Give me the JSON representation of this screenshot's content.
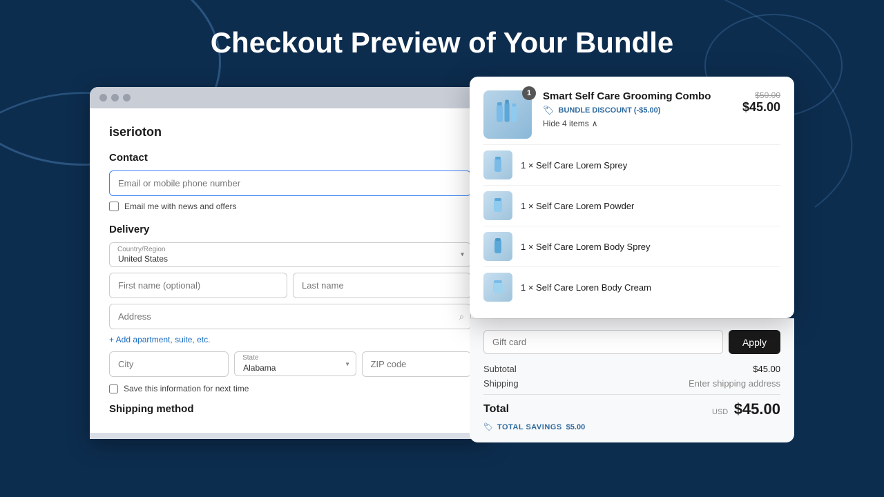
{
  "page": {
    "title": "Checkout Preview of Your Bundle",
    "background_color": "#0d2d4f"
  },
  "browser": {
    "store_name": "iserioton"
  },
  "contact": {
    "label": "Contact",
    "email_placeholder": "Email or mobile phone number",
    "newsletter_label": "Email me with news and offers"
  },
  "delivery": {
    "label": "Delivery",
    "country_label": "Country/Region",
    "country_value": "United States",
    "first_name_placeholder": "First name (optional)",
    "last_name_placeholder": "Last name",
    "address_placeholder": "Address",
    "add_apartment_label": "+ Add apartment, suite, etc.",
    "city_placeholder": "City",
    "state_label": "State",
    "state_value": "Alabama",
    "zip_placeholder": "ZIP code",
    "save_info_label": "Save this information for next time"
  },
  "shipping_method": {
    "label": "Shipping method"
  },
  "bundle": {
    "badge": "1",
    "title": "Smart Self Care Grooming Combo",
    "discount_label": "BUNDLE DISCOUNT (-$5.00)",
    "hide_items_label": "Hide 4 items",
    "original_price": "$50.00",
    "final_price": "$45.00",
    "items": [
      {
        "name": "1 × Self Care Lorem Sprey"
      },
      {
        "name": "1 × Self Care Lorem Powder"
      },
      {
        "name": "1 × Self Care Lorem Body Sprey"
      },
      {
        "name": "1 × Self Care Loren Body Cream"
      }
    ]
  },
  "order_summary": {
    "gift_card_placeholder": "Gift card",
    "apply_label": "Apply",
    "subtotal_label": "Subtotal",
    "subtotal_value": "$45.00",
    "shipping_label": "Shipping",
    "shipping_value": "Enter shipping address",
    "total_label": "Total",
    "total_currency": "USD",
    "total_value": "$45.00",
    "savings_label": "TOTAL SAVINGS",
    "savings_value": "$5.00"
  }
}
